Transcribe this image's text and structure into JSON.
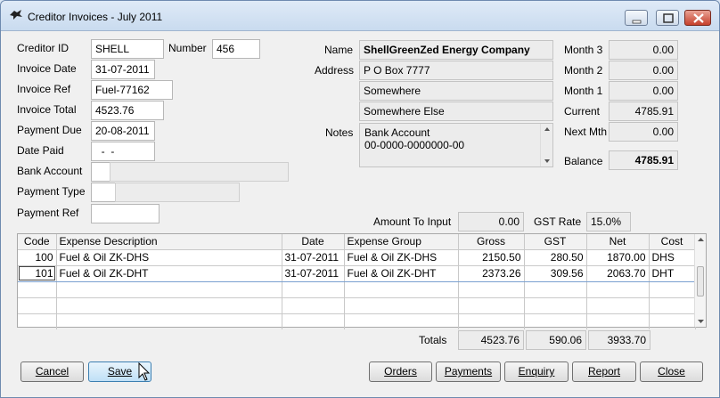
{
  "window": {
    "title": "Creditor Invoices - July 2011",
    "controls": {
      "minimize": "minimize-icon",
      "maximize": "maximize-icon",
      "close": "close-icon"
    }
  },
  "left": {
    "creditor_id_label": "Creditor ID",
    "creditor_id": "SHELL",
    "number_label": "Number",
    "number": "456",
    "invoice_date_label": "Invoice Date",
    "invoice_date": "31-07-2011",
    "invoice_ref_label": "Invoice Ref",
    "invoice_ref": "Fuel-77162",
    "invoice_total_label": "Invoice Total",
    "invoice_total": "4523.76",
    "payment_due_label": "Payment Due",
    "payment_due": "20-08-2011",
    "date_paid_label": "Date Paid",
    "date_paid": "  -  -",
    "bank_account_label": "Bank Account",
    "bank_account": "",
    "payment_type_label": "Payment Type",
    "payment_type": "",
    "payment_ref_label": "Payment Ref",
    "payment_ref": ""
  },
  "middle": {
    "name_label": "Name",
    "name": "ShellGreenZed Energy Company",
    "address_label": "Address",
    "address1": "P O Box 7777",
    "address2": "Somewhere",
    "address3": "Somewhere Else",
    "notes_label": "Notes",
    "notes_line1": "Bank Account",
    "notes_line2": "00-0000-0000000-00"
  },
  "aging": {
    "month3_label": "Month 3",
    "month3": "0.00",
    "month2_label": "Month 2",
    "month2": "0.00",
    "month1_label": "Month 1",
    "month1": "0.00",
    "current_label": "Current",
    "current": "4785.91",
    "next_label": "Next Mth",
    "next": "0.00",
    "balance_label": "Balance",
    "balance": "4785.91"
  },
  "input": {
    "amount_label": "Amount To Input",
    "amount": "0.00",
    "gst_label": "GST Rate",
    "gst": "15.0%"
  },
  "grid": {
    "headers": [
      "Code",
      "Expense Description",
      "Date",
      "Expense Group",
      "Gross",
      "GST",
      "Net",
      "Cost"
    ],
    "rows": [
      [
        "100",
        "Fuel & Oil ZK-DHS",
        "31-07-2011",
        "Fuel & Oil ZK-DHS",
        "2150.50",
        "280.50",
        "1870.00",
        "DHS"
      ],
      [
        "101",
        "Fuel & Oil ZK-DHT",
        "31-07-2011",
        "Fuel & Oil ZK-DHT",
        "2373.26",
        "309.56",
        "2063.70",
        "DHT"
      ]
    ]
  },
  "totals": {
    "label": "Totals",
    "gross": "4523.76",
    "gst": "590.06",
    "net": "3933.70"
  },
  "buttons": {
    "cancel": "Cancel",
    "save": "Save",
    "orders": "Orders",
    "payments": "Payments",
    "enquiry": "Enquiry",
    "report": "Report",
    "close": "Close"
  }
}
